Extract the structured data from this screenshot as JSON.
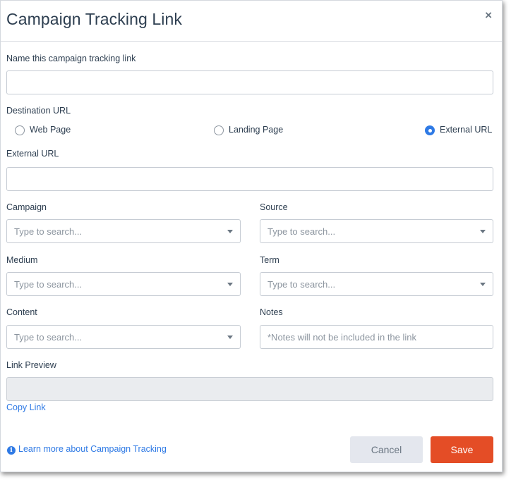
{
  "dialog": {
    "title": "Campaign Tracking Link",
    "close_glyph": "×"
  },
  "name_field": {
    "label": "Name this campaign tracking link",
    "value": ""
  },
  "destination": {
    "label": "Destination URL",
    "options": [
      {
        "label": "Web Page",
        "checked": false
      },
      {
        "label": "Landing Page",
        "checked": false
      },
      {
        "label": "External URL",
        "checked": true
      }
    ]
  },
  "external_url": {
    "label": "External URL",
    "value": ""
  },
  "campaign": {
    "label": "Campaign",
    "placeholder": "Type to search..."
  },
  "source": {
    "label": "Source",
    "placeholder": "Type to search..."
  },
  "medium": {
    "label": "Medium",
    "placeholder": "Type to search..."
  },
  "term": {
    "label": "Term",
    "placeholder": "Type to search..."
  },
  "content": {
    "label": "Content",
    "placeholder": "Type to search..."
  },
  "notes": {
    "label": "Notes",
    "placeholder": "*Notes will not be included in the link"
  },
  "link_preview": {
    "label": "Link Preview",
    "value": ""
  },
  "copy_link": "Copy Link",
  "learn_more": "Learn more about Campaign Tracking",
  "footer": {
    "cancel_label": "Cancel",
    "save_label": "Save"
  },
  "colors": {
    "accent": "#2f7ae5",
    "save": "#e44d26",
    "text": "#2d3e50"
  },
  "icons": [
    "close-icon",
    "radio-icon",
    "caret-down-icon",
    "info-icon"
  ]
}
